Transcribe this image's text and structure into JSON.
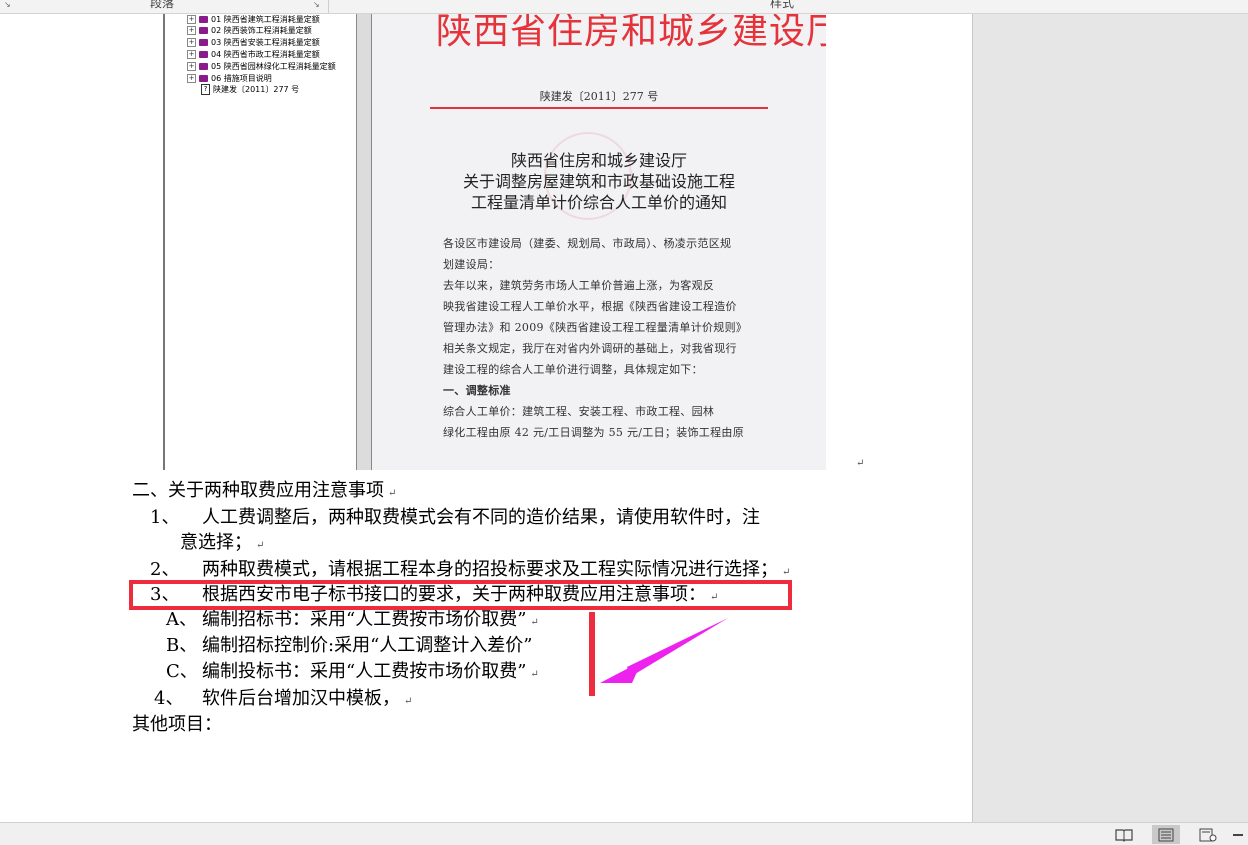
{
  "ribbon": {
    "group1": "段落",
    "group2": "样式"
  },
  "embedded": {
    "tree_items": [
      "01 陕西省建筑工程消耗量定额",
      "02 陕西装饰工程消耗量定额",
      "03 陕西省安装工程消耗量定额",
      "04 陕西省市政工程消耗量定额",
      "05 陕西省园林绿化工程消耗量定额",
      "06 措施项目说明"
    ],
    "tree_doc_item": "陕建发〔2011〕277 号",
    "scan": {
      "header": "陕西省住房和城乡建设厅文件",
      "doc_no": "陕建发〔2011〕277 号",
      "title_lines": [
        "陕西省住房和城乡建设厅",
        "关于调整房屋建筑和市政基础设施工程",
        "工程量清单计价综合人工单价的通知"
      ],
      "body_lines": [
        "各设区市建设局（建委、规划局、市政局）、杨凌示范区规",
        "划建设局：",
        "    去年以来，建筑劳务市场人工单价普遍上涨，为客观反",
        "映我省建设工程人工单价水平，根据《陕西省建设工程造价",
        "管理办法》和 2009《陕西省建设工程工程量清单计价规则》",
        "相关条文规定，我厅在对省内外调研的基础上，对我省现行",
        "建设工程的综合人工单价进行调整，具体规定如下：",
        "    一、调整标准",
        "    综合人工单价：建筑工程、安装工程、市政工程、园林",
        "绿化工程由原 42 元/工日调整为 55 元/工日；装饰工程由原"
      ]
    }
  },
  "doc": {
    "heading2": "二、关于两种取费应用注意事项",
    "item1_num": "1、",
    "item1_line1": "人工费调整后，两种取费模式会有不同的造价结果，请使用软件时，注",
    "item1_line2": "意选择；",
    "item2_num": "2、",
    "item2_text": "两种取费模式，请根据工程本身的招投标要求及工程实际情况进行选择；",
    "item3_num": "3、",
    "item3_text": "根据西安市电子标书接口的要求，关于两种取费应用注意事项：",
    "subA_num": "A、",
    "subA_text": "编制招标书：采用“人工费按市场价取费”",
    "subB_num": "B、",
    "subB_text": "编制招标控制价:采用“人工调整计入差价”",
    "subC_num": "C、",
    "subC_text": "编制投标书：采用“人工费按市场价取费”",
    "item4_num": "4、",
    "item4_text": "软件后台增加汉中模板，",
    "other": "其他项目：",
    "para_mark": "↵"
  },
  "colors": {
    "highlight_red": "#ed2d3d",
    "arrow_magenta": "#ee22ee",
    "stamp_red": "#e4333a"
  },
  "statusbar": {
    "icons": [
      "read-mode-icon",
      "print-layout-icon",
      "web-layout-icon",
      "zoom-out-icon"
    ]
  }
}
